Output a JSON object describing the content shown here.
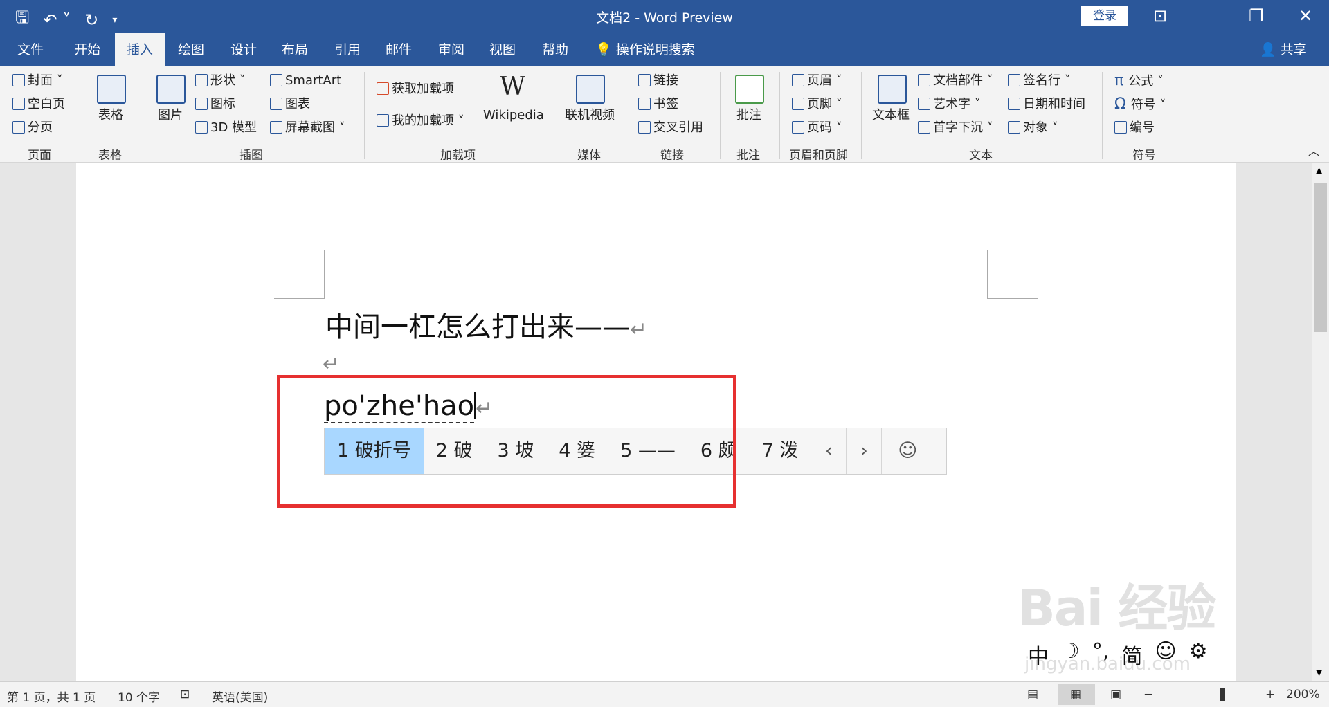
{
  "titlebar": {
    "title": "文档2  -  Word Preview",
    "login_label": "登录",
    "qat": {
      "save_icon": "save-icon",
      "undo_icon": "undo-icon",
      "redo_icon": "redo-icon",
      "customize_icon": "dropdown-icon"
    }
  },
  "tabs": [
    {
      "label": "文件"
    },
    {
      "label": "开始"
    },
    {
      "label": "插入",
      "active": true
    },
    {
      "label": "绘图"
    },
    {
      "label": "设计"
    },
    {
      "label": "布局"
    },
    {
      "label": "引用"
    },
    {
      "label": "邮件"
    },
    {
      "label": "审阅"
    },
    {
      "label": "视图"
    },
    {
      "label": "帮助"
    }
  ],
  "tellme": "操作说明搜索",
  "share": "共享",
  "ribbon": {
    "pages": {
      "cover": "封面",
      "blank": "空白页",
      "break": "分页",
      "group": "页面"
    },
    "tables": {
      "table": "表格",
      "group": "表格"
    },
    "illustrations": {
      "picture": "图片",
      "shapes": "形状",
      "icons": "图标",
      "model3d": "3D 模型",
      "smartart": "SmartArt",
      "chart": "图表",
      "screenshot": "屏幕截图",
      "group": "插图"
    },
    "addins": {
      "get": "获取加载项",
      "my": "我的加载项",
      "wikipedia": "Wikipedia",
      "group": "加载项"
    },
    "media": {
      "video": "联机视频",
      "group": "媒体"
    },
    "links": {
      "link": "链接",
      "bookmark": "书签",
      "crossref": "交叉引用",
      "group": "链接"
    },
    "comments": {
      "comment": "批注",
      "group": "批注"
    },
    "headerfooter": {
      "header": "页眉",
      "footer": "页脚",
      "pagenum": "页码",
      "group": "页眉和页脚"
    },
    "text": {
      "textbox": "文本框",
      "parts": "文档部件",
      "wordart": "艺术字",
      "dropcap": "首字下沉",
      "signature": "签名行",
      "datetime": "日期和时间",
      "object": "对象",
      "group": "文本"
    },
    "symbols": {
      "equation": "公式",
      "symbol": "符号",
      "number": "编号",
      "group": "符号"
    }
  },
  "document": {
    "line1": "中间一杠怎么打出来——",
    "line3": "po'zhe'hao"
  },
  "ime": {
    "candidates": [
      {
        "label": "1 破折号",
        "selected": true
      },
      {
        "label": "2 破"
      },
      {
        "label": "3 坡"
      },
      {
        "label": "4 婆"
      },
      {
        "label": "5 ——"
      },
      {
        "label": "6 颇"
      },
      {
        "label": "7 泼"
      }
    ],
    "prev": "‹",
    "next": "›",
    "emoji": "☺"
  },
  "imebar": {
    "mode": "中",
    "moon": "☽",
    "punct": "°,",
    "simp": "简",
    "emoji": "☺",
    "settings": "⚙"
  },
  "status": {
    "page": "第 1 页，共 1 页",
    "words": "10 个字",
    "language": "英语(美国)",
    "zoom": "200%"
  },
  "watermark": {
    "main": "Bai 经验",
    "sub": "jingyan.baidu.com"
  }
}
